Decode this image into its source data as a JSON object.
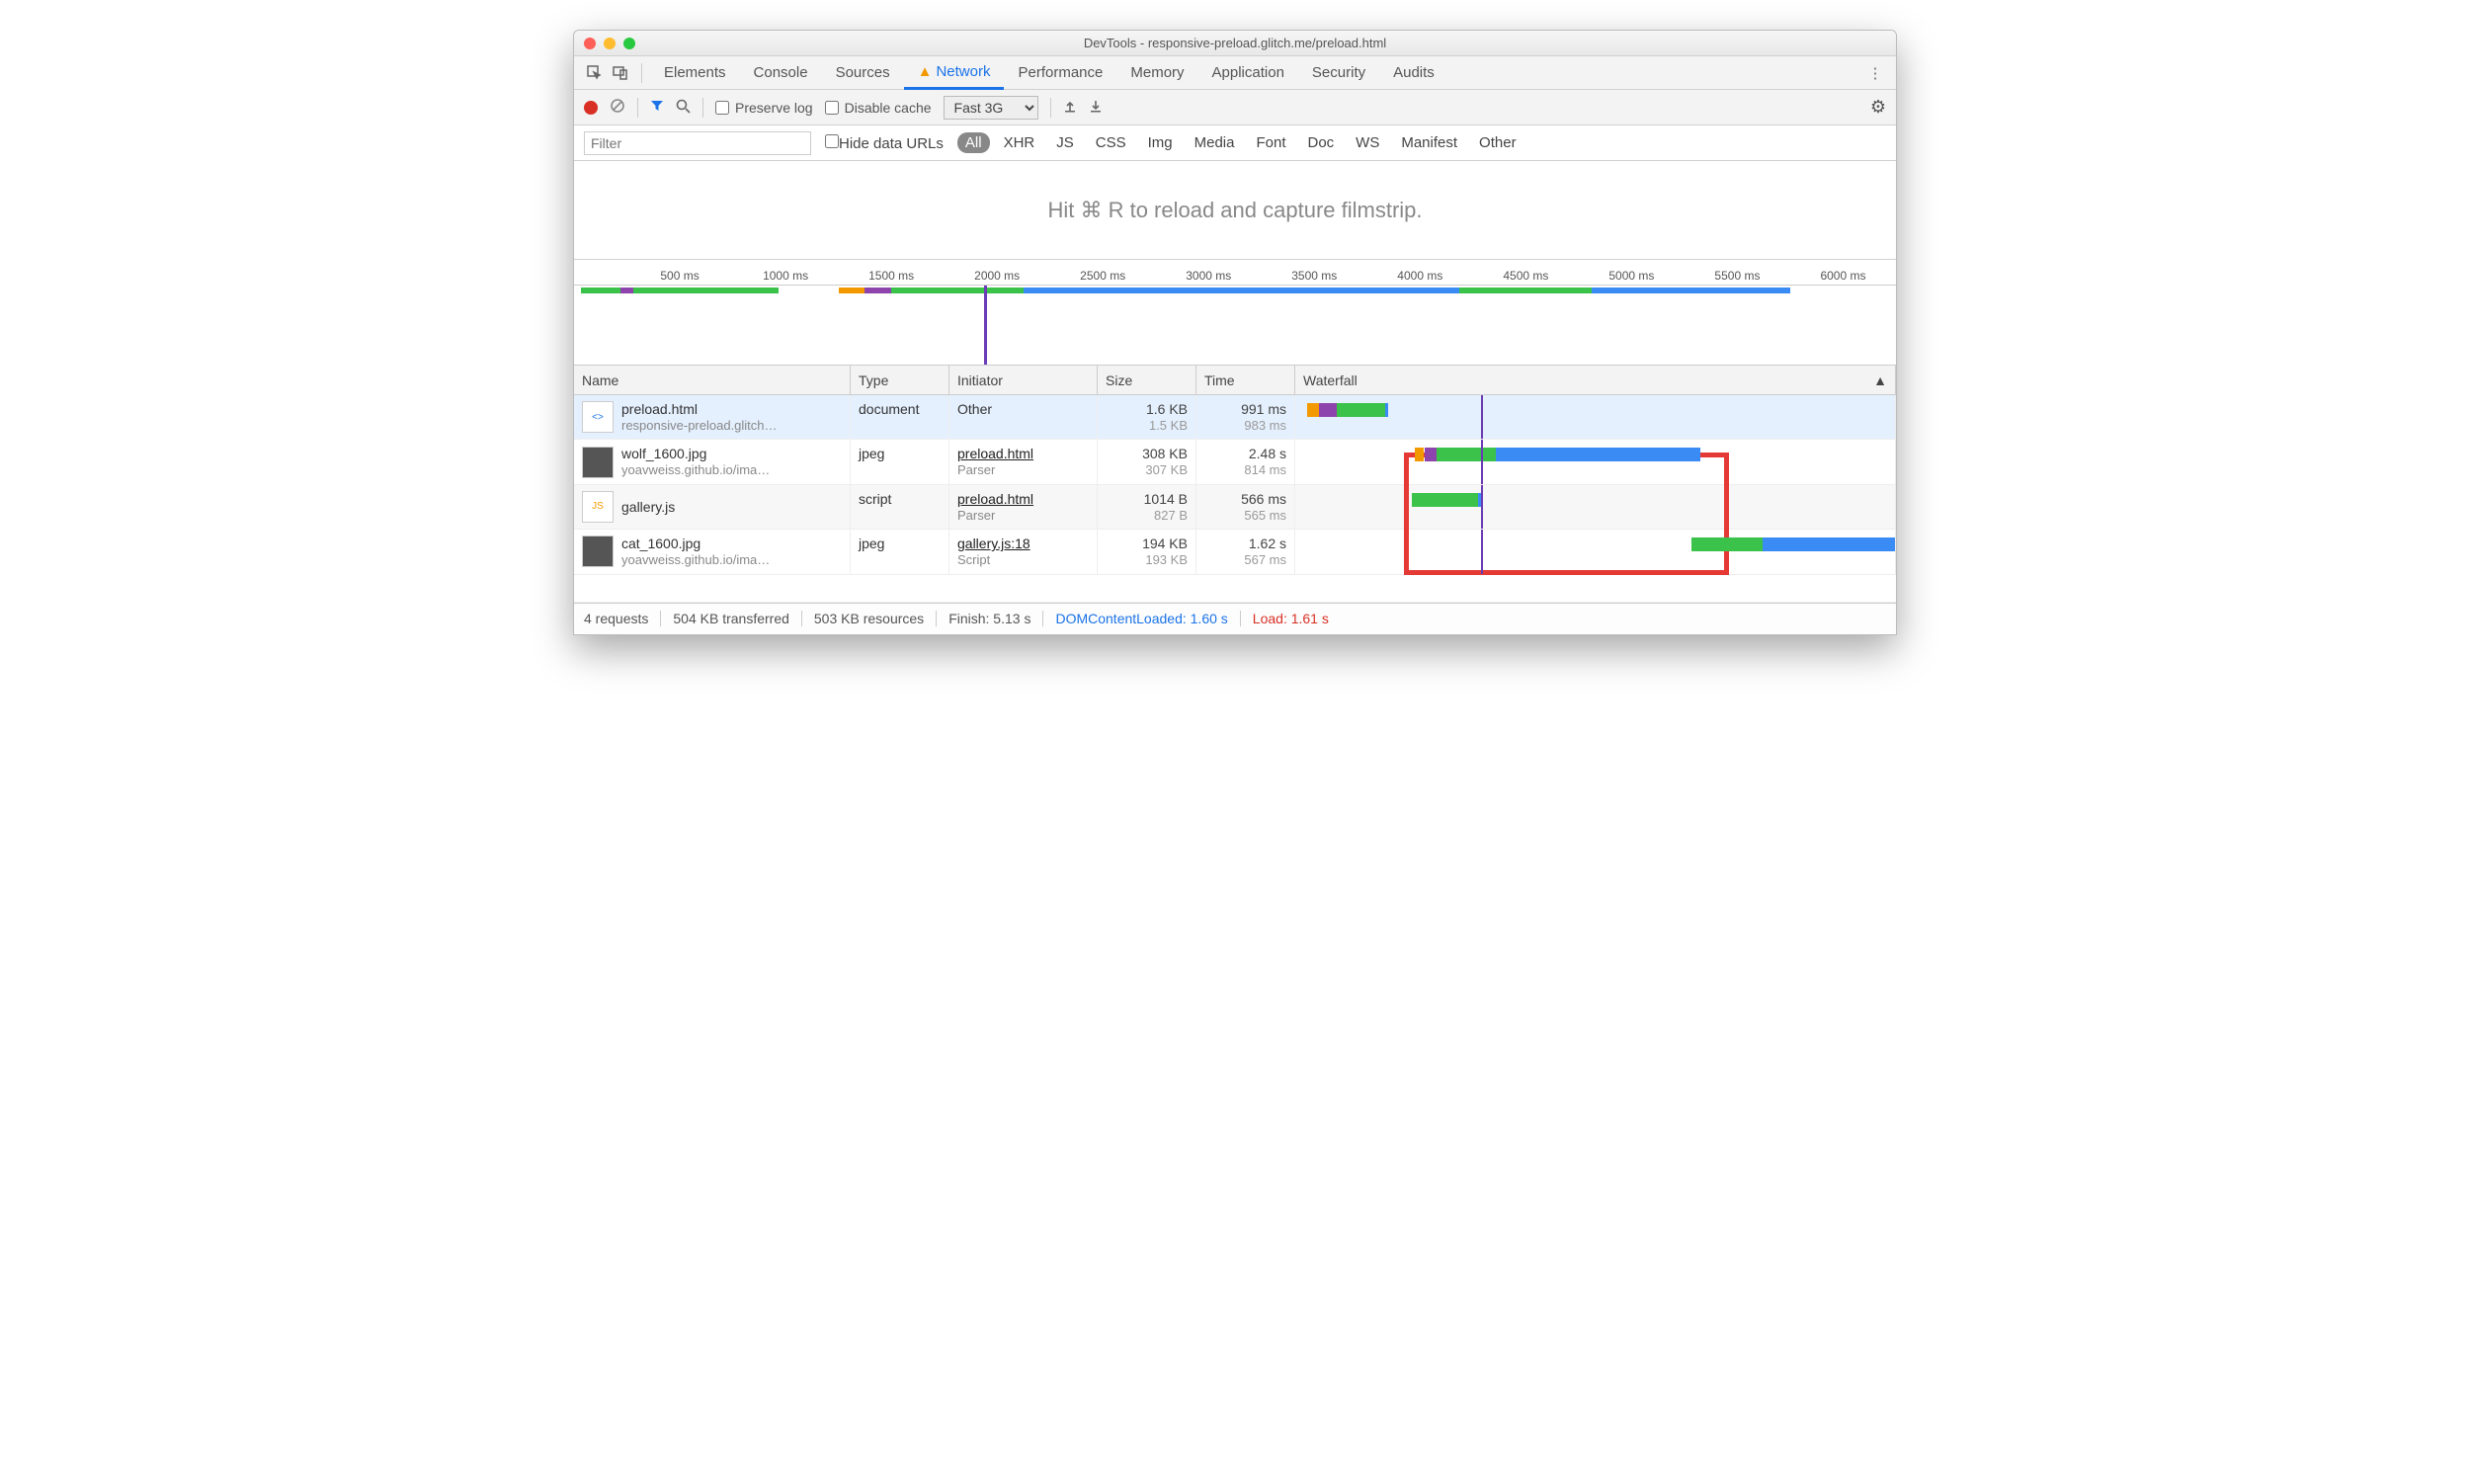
{
  "window": {
    "title": "DevTools - responsive-preload.glitch.me/preload.html"
  },
  "tabs": {
    "items": [
      "Elements",
      "Console",
      "Sources",
      "Network",
      "Performance",
      "Memory",
      "Application",
      "Security",
      "Audits"
    ],
    "active": "Network",
    "network_has_warning": true
  },
  "toolbar": {
    "preserve_log": "Preserve log",
    "disable_cache": "Disable cache",
    "throttling": "Fast 3G"
  },
  "filterbar": {
    "placeholder": "Filter",
    "hide_data_urls": "Hide data URLs",
    "types": [
      "All",
      "XHR",
      "JS",
      "CSS",
      "Img",
      "Media",
      "Font",
      "Doc",
      "WS",
      "Manifest",
      "Other"
    ],
    "active": "All"
  },
  "filmstrip_hint": "Hit ⌘ R to reload and capture filmstrip.",
  "timeline": {
    "ticks": [
      "500 ms",
      "1000 ms",
      "1500 ms",
      "2000 ms",
      "2500 ms",
      "3000 ms",
      "3500 ms",
      "4000 ms",
      "4500 ms",
      "5000 ms",
      "5500 ms",
      "6000 ms"
    ],
    "marker_pct": 31
  },
  "columns": {
    "name": "Name",
    "type": "Type",
    "initiator": "Initiator",
    "size": "Size",
    "time": "Time",
    "waterfall": "Waterfall"
  },
  "rows": [
    {
      "name": "preload.html",
      "sub": "responsive-preload.glitch…",
      "thumb": "doc",
      "type": "document",
      "initiator": "Other",
      "initiator_sub": "",
      "size": "1.6 KB",
      "size_sub": "1.5 KB",
      "time": "991 ms",
      "time_sub": "983 ms",
      "selected": true,
      "wf": [
        {
          "c": "q",
          "l": 2,
          "w": 2
        },
        {
          "c": "p",
          "l": 4,
          "w": 3
        },
        {
          "c": "g",
          "l": 7,
          "w": 8
        },
        {
          "c": "b",
          "l": 15,
          "w": 0.5
        }
      ]
    },
    {
      "name": "wolf_1600.jpg",
      "sub": "yoavweiss.github.io/ima…",
      "thumb": "img",
      "type": "jpeg",
      "initiator": "preload.html",
      "initiator_sub": "Parser",
      "initiator_link": true,
      "size": "308 KB",
      "size_sub": "307 KB",
      "time": "2.48 s",
      "time_sub": "814 ms",
      "wf": [
        {
          "c": "q",
          "l": 20,
          "w": 1.5
        },
        {
          "c": "p",
          "l": 21.5,
          "w": 2
        },
        {
          "c": "g",
          "l": 23.5,
          "w": 10
        },
        {
          "c": "b",
          "l": 33.5,
          "w": 34
        }
      ]
    },
    {
      "name": "gallery.js",
      "sub": "",
      "thumb": "js",
      "type": "script",
      "initiator": "preload.html",
      "initiator_sub": "Parser",
      "initiator_link": true,
      "size": "1014 B",
      "size_sub": "827 B",
      "time": "566 ms",
      "time_sub": "565 ms",
      "alt": true,
      "wf": [
        {
          "c": "g",
          "l": 19.5,
          "w": 11
        },
        {
          "c": "b",
          "l": 30.5,
          "w": 0.5
        }
      ]
    },
    {
      "name": "cat_1600.jpg",
      "sub": "yoavweiss.github.io/ima…",
      "thumb": "img",
      "type": "jpeg",
      "initiator": "gallery.js:18",
      "initiator_sub": "Script",
      "initiator_link": true,
      "size": "194 KB",
      "size_sub": "193 KB",
      "time": "1.62 s",
      "time_sub": "567 ms",
      "wf": [
        {
          "c": "g",
          "l": 66,
          "w": 12
        },
        {
          "c": "b",
          "l": 78,
          "w": 22
        }
      ]
    }
  ],
  "highlight": {
    "left_pct": 18,
    "width_pct": 54
  },
  "dcl_line_pct": 31,
  "status": {
    "requests": "4 requests",
    "transferred": "504 KB transferred",
    "resources": "503 KB resources",
    "finish": "Finish: 5.13 s",
    "dcl": "DOMContentLoaded: 1.60 s",
    "load": "Load: 1.61 s"
  }
}
